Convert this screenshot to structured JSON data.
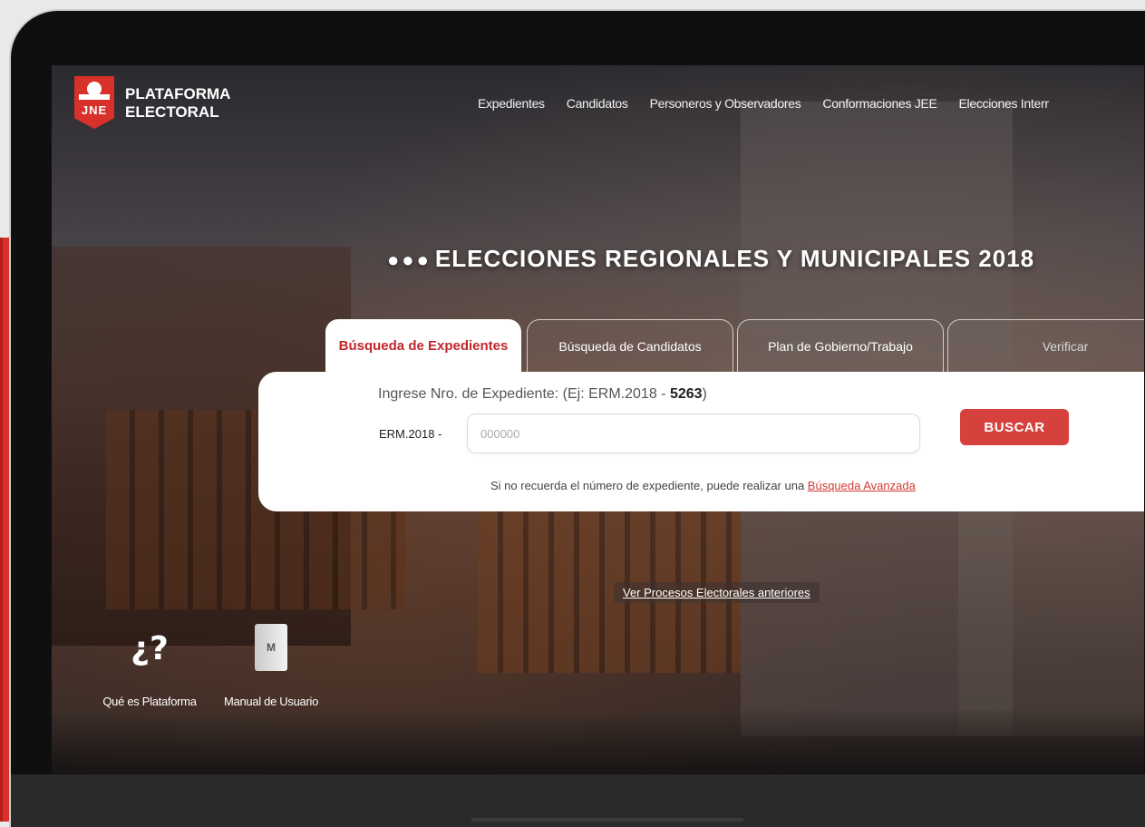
{
  "brand": {
    "line1": "PLATAFORMA",
    "line2": "ELECTORAL",
    "logo_text": "JNE"
  },
  "nav": {
    "items": [
      "Expedientes",
      "Candidatos",
      "Personeros y Observadores",
      "Conformaciones JEE",
      "Elecciones Interr"
    ]
  },
  "headline": {
    "dots": "●●●",
    "title": "ELECCIONES REGIONALES Y MUNICIPALES 2018"
  },
  "tabs": [
    {
      "label": "Búsqueda de Expedientes",
      "active": true
    },
    {
      "label": "Búsqueda de Candidatos",
      "active": false
    },
    {
      "label": "Plan de Gobierno/Trabajo",
      "active": false
    },
    {
      "label": "Verificar",
      "active": false
    }
  ],
  "search": {
    "hint_prefix": "Ingrese Nro. de Expediente: (Ej: ERM.2018 - ",
    "hint_example": "5263",
    "hint_suffix": ")",
    "field_prefix": "ERM.2018 -",
    "placeholder": "000000",
    "button": "BUSCAR",
    "remember_text": "Si no recuerda el número de expediente, puede realizar una ",
    "advanced_link": "Búsqueda Avanzada"
  },
  "prev_link": "Ver Procesos Electorales anteriores",
  "footer_links": {
    "help_symbol": "¿?",
    "help_label": "Qué es Plataforma",
    "manual_icon_text": "M",
    "manual_label": "Manual de Usuario"
  },
  "colors": {
    "accent": "#d8312b",
    "button": "#d7413d",
    "tab_active_text": "#c0262a"
  }
}
